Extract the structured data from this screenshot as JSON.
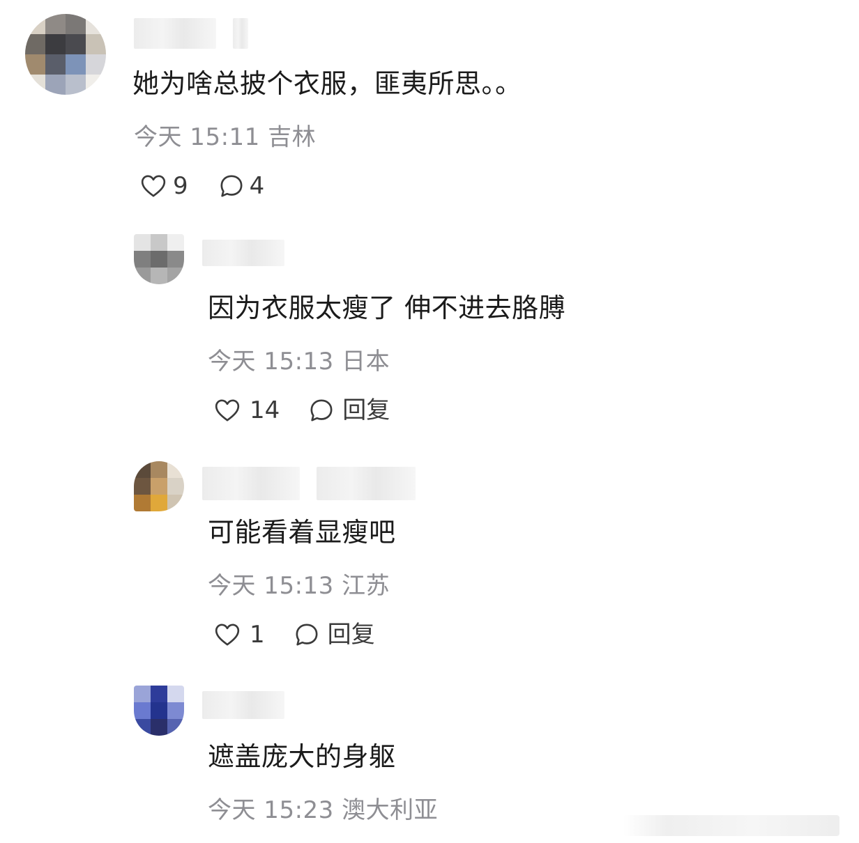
{
  "comments": [
    {
      "text": "她为啥总披个衣服，匪夷所思。。",
      "time": "今天 15:11",
      "location": "吉林",
      "likes": "9",
      "replies": "4"
    },
    {
      "text": "因为衣服太瘦了 伸不进去胳膊",
      "time": "今天 15:13",
      "location": "日本",
      "likes": "14",
      "reply_label": "回复"
    },
    {
      "text": "可能看着显瘦吧",
      "time": "今天 15:13",
      "location": "江苏",
      "likes": "1",
      "reply_label": "回复"
    },
    {
      "text": "遮盖庞大的身躯",
      "time": "今天 15:23",
      "location": "澳大利亚"
    }
  ],
  "icons": {
    "like": "heart-outline-icon",
    "reply": "speech-bubble-icon"
  },
  "colors": {
    "text": "#1b1b1b",
    "meta": "#8e8e93",
    "icon": "#3a3a3a"
  }
}
